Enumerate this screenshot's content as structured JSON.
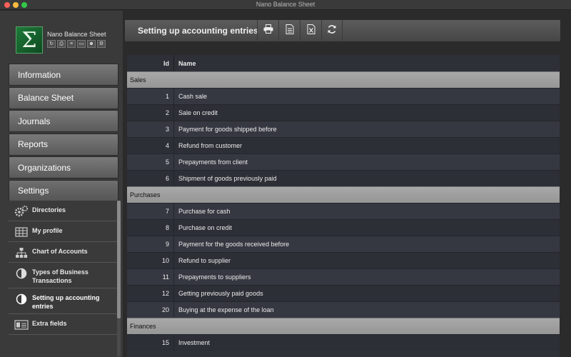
{
  "window": {
    "title": "Nano Balance Sheet"
  },
  "sidebar": {
    "app_name": "Nano Balance Sheet",
    "logo_glyph": "Σ",
    "mini_icons": [
      "refresh-icon",
      "print-icon",
      "document-icon",
      "copy-icon",
      "users-icon",
      "settings-icon"
    ],
    "nav": [
      {
        "label": "Information"
      },
      {
        "label": "Balance Sheet"
      },
      {
        "label": "Journals"
      },
      {
        "label": "Reports"
      },
      {
        "label": "Organizations"
      },
      {
        "label": "Settings"
      }
    ],
    "settings_items": [
      {
        "label": "Directories",
        "icon": "gears-icon"
      },
      {
        "label": "My profile",
        "icon": "grid-icon"
      },
      {
        "label": "Chart of Accounts",
        "icon": "hierarchy-icon"
      },
      {
        "label": "Types of Business Transactions",
        "icon": "half-circle-icon"
      },
      {
        "label": "Setting up accounting entries",
        "icon": "half-circle-icon",
        "active": true
      },
      {
        "label": "Extra fields",
        "icon": "form-icon"
      }
    ]
  },
  "toolbar": {
    "title": "Setting up accounting entries",
    "buttons": [
      "print-icon",
      "document-icon",
      "excel-icon",
      "refresh-icon"
    ]
  },
  "table": {
    "headers": {
      "id": "Id",
      "name": "Name"
    },
    "groups": [
      {
        "name": "Sales",
        "rows": [
          {
            "id": "1",
            "name": "Cash sale"
          },
          {
            "id": "2",
            "name": "Sale on credit"
          },
          {
            "id": "3",
            "name": "Payment for goods shipped before"
          },
          {
            "id": "4",
            "name": "Refund from customer"
          },
          {
            "id": "5",
            "name": "Prepayments from client"
          },
          {
            "id": "6",
            "name": "Shipment of goods previously paid"
          }
        ]
      },
      {
        "name": "Purchases",
        "rows": [
          {
            "id": "7",
            "name": "Purchase for cash"
          },
          {
            "id": "8",
            "name": "Purchase on credit"
          },
          {
            "id": "9",
            "name": "Payment for the goods received before"
          },
          {
            "id": "10",
            "name": "Refund to supplier"
          },
          {
            "id": "11",
            "name": "Prepayments to suppliers"
          },
          {
            "id": "12",
            "name": "Getting previously paid goods"
          },
          {
            "id": "20",
            "name": "Buying at the expense of the loan"
          }
        ]
      },
      {
        "name": "Finances",
        "rows": [
          {
            "id": "15",
            "name": "Investment"
          }
        ]
      }
    ]
  },
  "colors": {
    "group_header": "#a0a0a0",
    "row_odd": "#353841",
    "row_even": "#2c2f36"
  }
}
